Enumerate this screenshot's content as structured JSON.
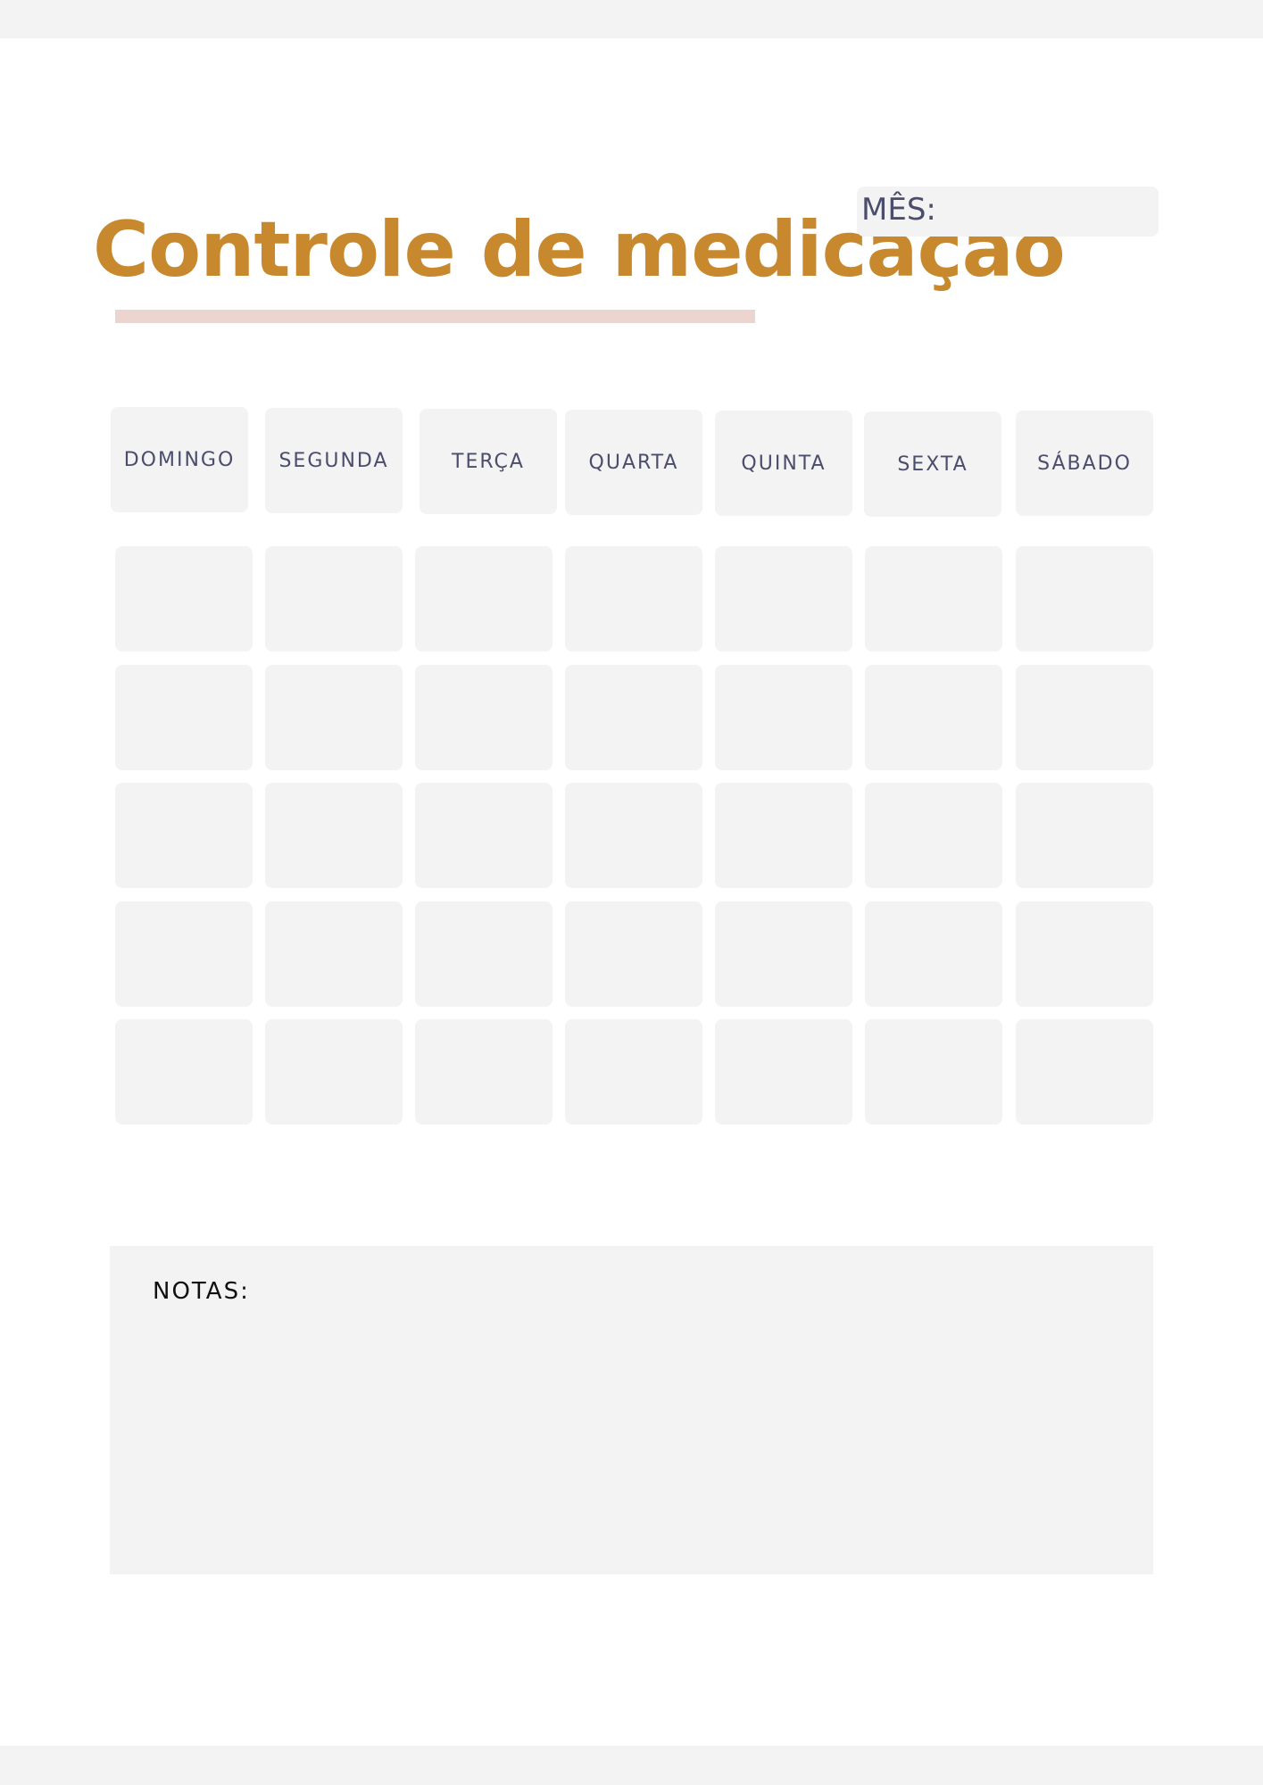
{
  "title": "Controle de medicação",
  "month": {
    "label": "MÊS:"
  },
  "days": [
    "DOMINGO",
    "SEGUNDA",
    "TERÇA",
    "QUARTA",
    "QUINTA",
    "SEXTA",
    "SÁBADO"
  ],
  "grid": {
    "rows": 5,
    "columns": 7
  },
  "notes": {
    "label": "NOTAS:"
  },
  "colors": {
    "title": "#c8892e",
    "underline": "#ecd4cf",
    "box": "#f3f3f3",
    "day_text": "#4a4d6b"
  }
}
